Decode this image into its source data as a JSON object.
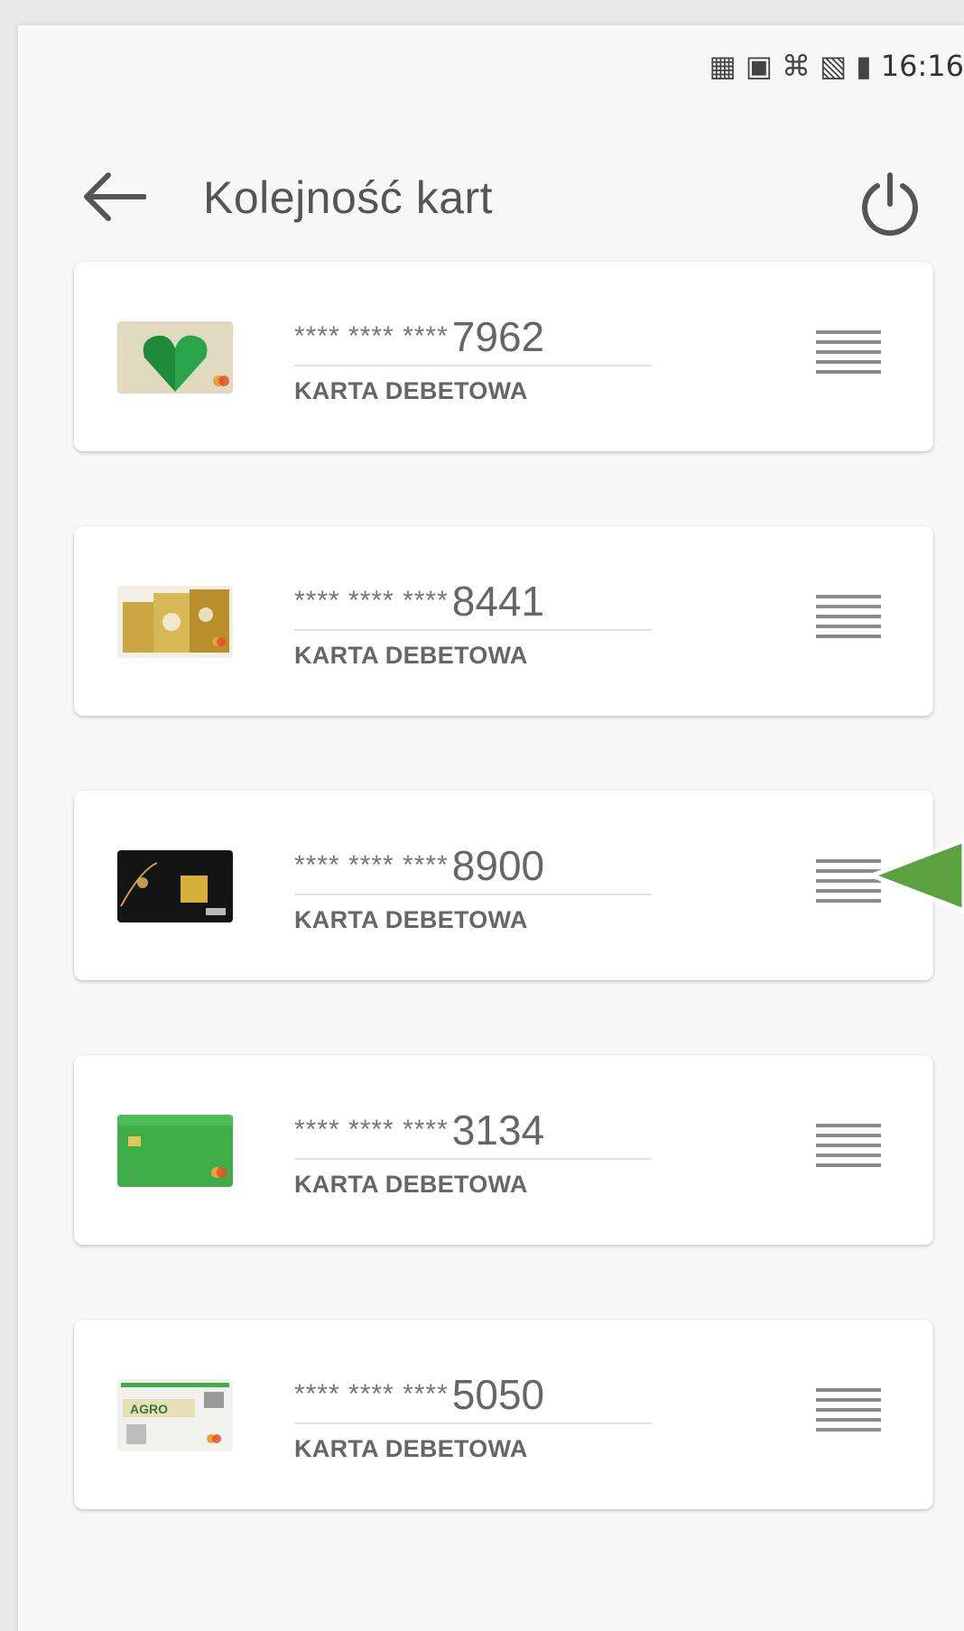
{
  "status_bar": {
    "icons": [
      "nfc-icon",
      "vibrate-icon",
      "wifi-calling-icon",
      "signal-icon",
      "battery-icon"
    ],
    "time": "16:16"
  },
  "header": {
    "title": "Kolejność kart"
  },
  "cards": [
    {
      "masked": "**** **** ****",
      "last4": "7962",
      "type": "KARTA DEBETOWA",
      "thumb": "card-heart"
    },
    {
      "masked": "**** **** ****",
      "last4": "8441",
      "type": "KARTA DEBETOWA",
      "thumb": "card-gold"
    },
    {
      "masked": "**** **** ****",
      "last4": "8900",
      "type": "KARTA DEBETOWA",
      "thumb": "card-black"
    },
    {
      "masked": "**** **** ****",
      "last4": "3134",
      "type": "KARTA DEBETOWA",
      "thumb": "card-green"
    },
    {
      "masked": "**** **** ****",
      "last4": "5050",
      "type": "KARTA DEBETOWA",
      "thumb": "card-agro",
      "thumb_text": "AGRO"
    }
  ],
  "colors": {
    "accent_green": "#5aa23f",
    "card_green": "#3fae49",
    "heart_green": "#1f8a3a",
    "gold": "#c9a642",
    "black_card": "#141414"
  }
}
